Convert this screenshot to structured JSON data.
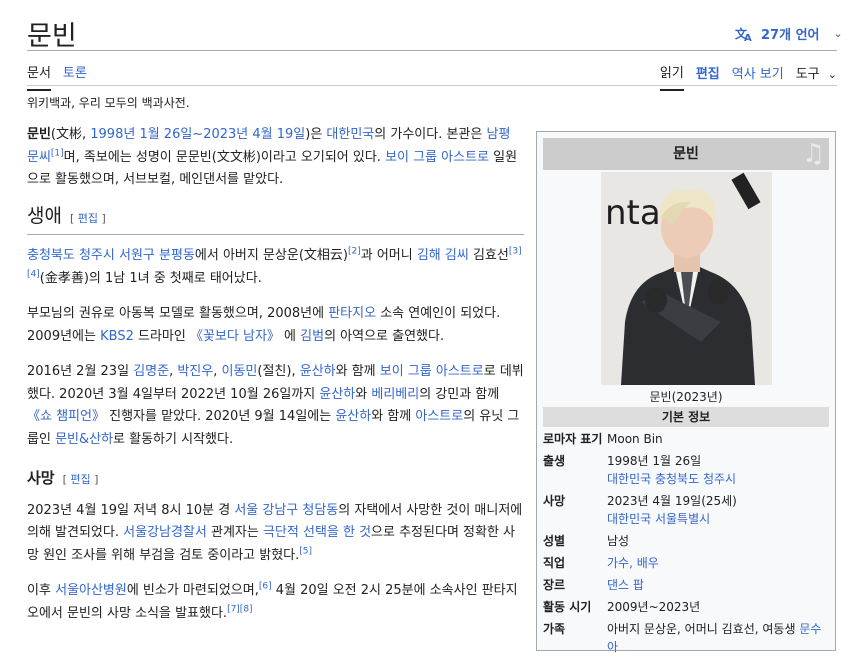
{
  "page": {
    "title": "문빈",
    "language_button": "27개 언어",
    "tabs_left": [
      "문서",
      "토론"
    ],
    "tabs_right": [
      "읽기",
      "편집",
      "역사 보기",
      "도구"
    ],
    "tagline": "위키백과, 우리 모두의 백과사전."
  },
  "content": {
    "intro": {
      "name": "문빈",
      "hanja": "(文彬, ",
      "dates": "1998년 1월 26일~2023년 4월 19일",
      "t1": ")은 ",
      "country": "대한민국",
      "t2": "의 가수이다. 본관은 ",
      "clan": "남평 문씨",
      "ref1": "[1]",
      "t3": "며, 족보에는 성명이 문문빈(文文彬)이라고 오기되어 있다. ",
      "group": "보이 그룹 아스트로",
      "t4": " 일원으로 활동했으며, 서브보컬, 메인댄서를 맡았다."
    },
    "section_edit": "편집",
    "life": {
      "heading": "생애",
      "p1_place": "충청북도 청주시 서원구 분평동",
      "p1_t1": "에서 아버지 문상운(文相云)",
      "p1_ref2": "[2]",
      "p1_t2": "과 어머니 ",
      "p1_clan": "김해 김씨",
      "p1_t3": " 김효선",
      "p1_ref34": "[3][4]",
      "p1_t4": "(金孝善)의 1남 1녀 중 첫째로 태어났다.",
      "p2_t1": "부모님의 권유로 아동복 모델로 활동했으며, 2008년에 ",
      "p2_agency": "판타지오",
      "p2_t2": " 소속 연예인이 되었다. 2009년에는 ",
      "p2_kbs": "KBS2",
      "p2_t3": " 드라마인 ",
      "p2_drama": "《꽃보다 남자》",
      "p2_t4": " 에 ",
      "p2_role": "김범",
      "p2_t5": "의 아역으로 출연했다.",
      "p3_t1": "2016년 2월 23일 ",
      "p3_m1": "김명준",
      "p3_c1": ", ",
      "p3_m2": "박진우",
      "p3_c2": ", ",
      "p3_m3": "이동민",
      "p3_t2": "(절친), ",
      "p3_m4": "윤산하",
      "p3_t3": "와 함께 ",
      "p3_group": "보이 그룹 아스트로",
      "p3_t4": "로 데뷔했다. 2020년 3월 4일부터 2022년 10월 26일까지 ",
      "p3_m5": "윤산하",
      "p3_t5": "와 ",
      "p3_verivery": "베리베리",
      "p3_t6": "의 강민과 함께 ",
      "p3_show": "《쇼 챔피언》",
      "p3_t7": " 진행자를 맡았다. 2020년 9월 14일에는 ",
      "p3_m6": "윤산하",
      "p3_t8": "와 함께 ",
      "p3_astro": "아스트로",
      "p3_t9": "의 유닛 그룹인 ",
      "p3_unit": "문빈&산하",
      "p3_t10": "로 활동하기 시작했다."
    },
    "death": {
      "heading": "사망",
      "p1_t1": "2023년 4월 19일 저녁 8시 10분 경 ",
      "p1_place": "서울 강남구 청담동",
      "p1_t2": "의 자택에서 사망한 것이 매니저에 의해 발견되었다. ",
      "p1_police": "서울강남경찰서",
      "p1_t3": " 관계자는 ",
      "p1_suicide": "극단적 선택을 한 것",
      "p1_t4": "으로 추정된다며 정확한 사망 원인 조사를 위해 부검을 검토 중이라고 밝혔다.",
      "p1_ref5": "[5]",
      "p2_t1": "이후 ",
      "p2_hospital": "서울아산병원",
      "p2_t2": "에 빈소가 마련되었으며,",
      "p2_ref6": "[6]",
      "p2_t3": " 4월 20일 오전 2시 25분에 소속사인 판타지오에서 문빈의 사망 소식을 발표했다.",
      "p2_ref78": "[7][8]"
    }
  },
  "infobox": {
    "title": "문빈",
    "caption": "문빈(2023년)",
    "section": "기본 정보",
    "rows": [
      {
        "label": "로마자 표기",
        "value": "Moon Bin",
        "sub": ""
      },
      {
        "label": "출생",
        "value": "1998년 1월 26일",
        "sub": "대한민국 충청북도 청주시"
      },
      {
        "label": "사망",
        "value": "2023년 4월 19일(25세)",
        "sub": "대한민국 서울특별시"
      },
      {
        "label": "성별",
        "value": "남성",
        "sub": ""
      },
      {
        "label": "직업",
        "value": "가수, 배우",
        "sub": ""
      },
      {
        "label": "장르",
        "value": "댄스 팝",
        "sub": ""
      },
      {
        "label": "활동 시기",
        "value": "2009년~2023년",
        "sub": ""
      },
      {
        "label": "가족",
        "value": "아버지 문상운, 어머니 김효선, 여동생 ",
        "link": "문수아"
      }
    ],
    "photo_backdrop_text": "ntasio"
  },
  "colors": {
    "link": "#3366cc",
    "text": "#202122",
    "infobox_header": "#cccccc",
    "infobox_section": "#dddddd"
  }
}
